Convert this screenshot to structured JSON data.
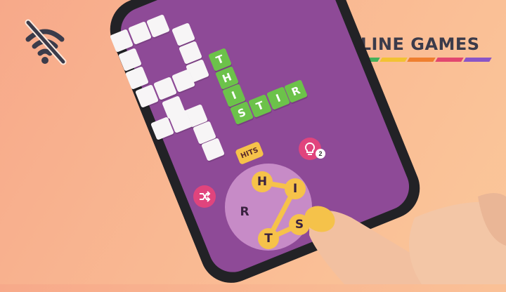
{
  "banner": {
    "title": "OFFLINE GAMES"
  },
  "icons": {
    "wifi_off": "wifi-off-icon",
    "hint": "lightbulb-icon",
    "shuffle": "shuffle-icon"
  },
  "stripe_colors": [
    "#3f8fd8",
    "#46b15a",
    "#f2c233",
    "#ef7f2f",
    "#e2476f",
    "#8a55c6"
  ],
  "colors": {
    "screen": "#8e4a97",
    "tile_white": "#f7f5f6",
    "tile_green": "#6cc24a",
    "accent_yellow": "#f6c24a",
    "button_pink": "#e0447d"
  },
  "board": {
    "vertical_word": [
      "T",
      "H",
      "I",
      "S"
    ],
    "horizontal_word": [
      "S",
      "T",
      "I",
      "R"
    ]
  },
  "current_word": "HITS",
  "hint": {
    "count": "2"
  },
  "wheel": {
    "letters": [
      "H",
      "I",
      "R",
      "T",
      "S"
    ]
  }
}
